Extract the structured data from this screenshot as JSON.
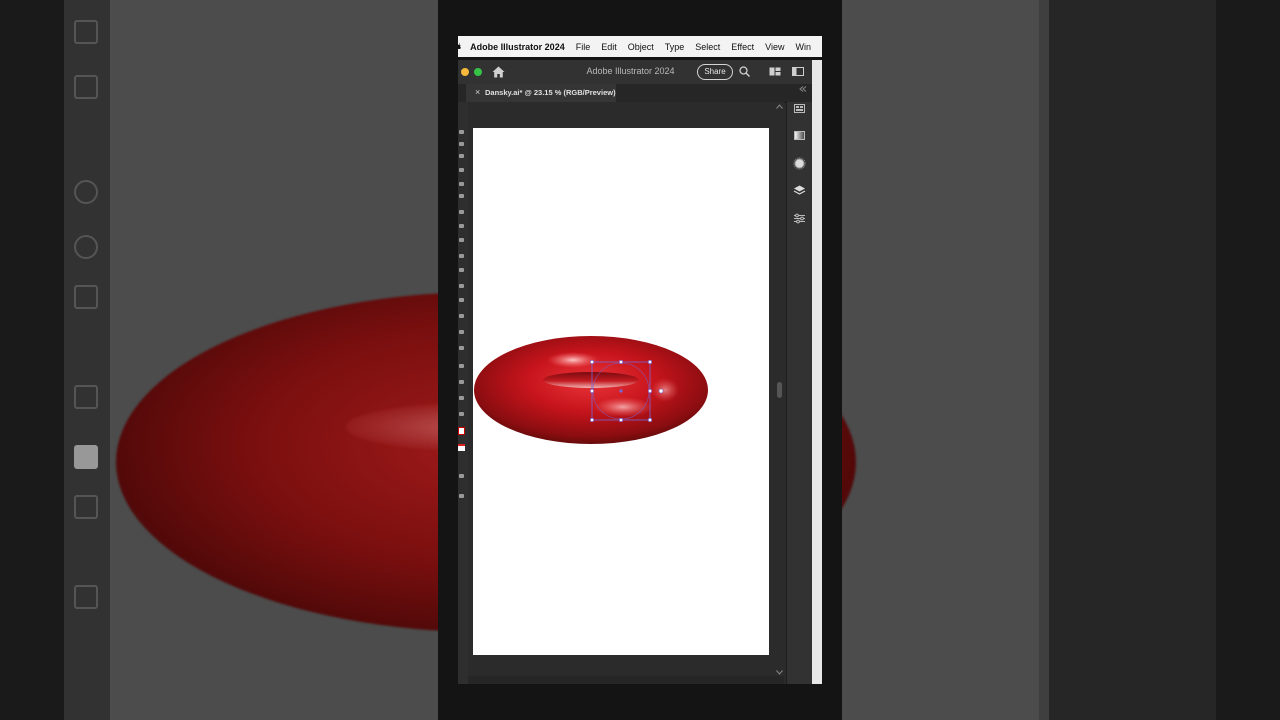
{
  "menubar": {
    "app_name": "Adobe Illustrator 2024",
    "items": [
      "File",
      "Edit",
      "Object",
      "Type",
      "Select",
      "Effect",
      "View",
      "Win"
    ]
  },
  "window": {
    "title": "Adobe Illustrator 2024",
    "share_label": "Share"
  },
  "tab": {
    "close_glyph": "×",
    "label": "Dansky.ai* @ 23.15 % (RGB/Preview)"
  },
  "colors": {
    "torus_base": "#c8141c",
    "torus_dark": "#5e0a0a",
    "selection": "#6a5acd"
  },
  "icons": {
    "right_panel": [
      "libraries-icon",
      "gradient-icon",
      "appearance-icon",
      "layers-icon",
      "properties-icon"
    ]
  }
}
